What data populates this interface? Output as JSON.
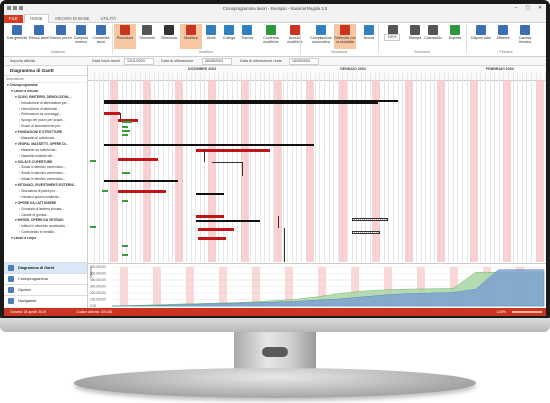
{
  "app": {
    "title": "Cronoprogramma lavori - Esempio - Namirial Regolo 3.0",
    "window_buttons": [
      "–",
      "▢",
      "✕"
    ]
  },
  "ribbon_tabs": [
    "FILE",
    "HOME",
    "ARCHIVI DI BASE",
    "UTILITÀ"
  ],
  "ribbon": {
    "buttons": [
      {
        "label": "Dati generali",
        "icon": "document-icon"
      },
      {
        "label": "Elenco lavori",
        "icon": "list-icon"
      },
      {
        "label": "Elenco prezzi",
        "icon": "price-list-icon"
      },
      {
        "label": "Computo metrico",
        "icon": "calculator-icon"
      },
      {
        "label": "Contabilità lavori",
        "icon": "book-icon"
      },
      {
        "label": "Procedure",
        "icon": "flag-icon"
      },
      {
        "label": "Strumenti",
        "icon": "tools-icon"
      },
      {
        "label": "Seleziona",
        "icon": "pointer-icon"
      },
      {
        "label": "Modifica",
        "icon": "move-icon"
      },
      {
        "label": "Dividi",
        "icon": "split-icon"
      },
      {
        "label": "Collega",
        "icon": "link-icon"
      },
      {
        "label": "Traccia",
        "icon": "trace-icon"
      },
      {
        "label": "Conferma modifiche",
        "icon": "check-icon"
      },
      {
        "label": "Annulla modifiche",
        "icon": "cancel-icon"
      },
      {
        "label": "Compilazione automatica",
        "icon": "auto-icon"
      },
      {
        "label": "Raffronta con la modalità",
        "icon": "compare-icon"
      },
      {
        "label": "Nuova",
        "icon": "new-icon"
      },
      {
        "label": "Zoom",
        "icon": "zoom-icon"
      },
      {
        "label": "Stampa",
        "icon": "print-icon"
      },
      {
        "label": "Calendario",
        "icon": "calendar-icon"
      },
      {
        "label": "Esporta",
        "icon": "export-icon"
      },
      {
        "label": "Disponi tutto",
        "icon": "arrange-icon"
      },
      {
        "label": "Affianca",
        "icon": "tile-icon"
      },
      {
        "label": "Cambia finestra",
        "icon": "window-icon"
      }
    ],
    "zoom_value": "100%",
    "groups": [
      "Gestione",
      "Modifica",
      "Visualizza",
      "Strumenti",
      "Finestra"
    ]
  },
  "subbar": {
    "import_label": "Importa attività",
    "start_label": "Data inizio lavori",
    "start_value": "12/11/2003",
    "finish_label": "Data di ultimazione",
    "finish_value": "26/08/2004",
    "actual_label": "Data di ultimazione reale",
    "actual_value": "15/09/2004"
  },
  "leftpane": {
    "title": "Diagramma di Gantt",
    "columns": "Descrizione",
    "rows": [
      {
        "text": "Cronoprogramma",
        "bold": true,
        "indent": 0
      },
      {
        "text": "Lavori a misura",
        "bold": true,
        "indent": 1
      },
      {
        "text": "SCAVI, RINTERRI, DEMOLIZIONI,...",
        "bold": true,
        "indent": 2
      },
      {
        "text": "Introduzione di attrezzature per...",
        "bold": false,
        "indent": 3
      },
      {
        "text": "Demolizione di fabbricati...",
        "bold": false,
        "indent": 3
      },
      {
        "text": "Perforazioni ed ancoraggi...",
        "bold": false,
        "indent": 3
      },
      {
        "text": "Spurgo del pozzo per acque...",
        "bold": false,
        "indent": 3
      },
      {
        "text": "Scavo di sbancamento per...",
        "bold": false,
        "indent": 3
      },
      {
        "text": "FONDAZIONI E STRUTTURE",
        "bold": true,
        "indent": 2
      },
      {
        "text": "Massetto di sottofondo...",
        "bold": false,
        "indent": 3
      },
      {
        "text": "VESPAI, MASSETTI, OPERE DI...",
        "bold": true,
        "indent": 2
      },
      {
        "text": "Massetto da sottofondo...",
        "bold": false,
        "indent": 3
      },
      {
        "text": "Massetto isolante del...",
        "bold": false,
        "indent": 3
      },
      {
        "text": "SOLAI E COPERTURE",
        "bold": true,
        "indent": 2
      },
      {
        "text": "Solaio in laterizio cementizio...",
        "bold": false,
        "indent": 3
      },
      {
        "text": "Solaio in laterizio cementizio...",
        "bold": false,
        "indent": 3
      },
      {
        "text": "Solaio in laterizio cementizio...",
        "bold": false,
        "indent": 3
      },
      {
        "text": "INTONACI, RIVESTIMENTI ESTERNI...",
        "bold": true,
        "indent": 2
      },
      {
        "text": "Stuccatura di pareti per...",
        "bold": false,
        "indent": 3
      },
      {
        "text": "Intonaco grezzo costituito...",
        "bold": false,
        "indent": 3
      },
      {
        "text": "OPERE DA LATTONIERE",
        "bold": true,
        "indent": 2
      },
      {
        "text": "Grondaia di lamiera zincata...",
        "bold": false,
        "indent": 3
      },
      {
        "text": "Canale di gronda...",
        "bold": false,
        "indent": 3
      },
      {
        "text": "INFISSI, OPERE DA VETRAIO",
        "bold": true,
        "indent": 2
      },
      {
        "text": "Infisso in alluminio anodizzato...",
        "bold": false,
        "indent": 3
      },
      {
        "text": "Controtelaio in metallo...",
        "bold": false,
        "indent": 3
      },
      {
        "text": "Lavori a corpo",
        "bold": true,
        "indent": 1
      }
    ],
    "nav": [
      {
        "label": "Diagramma di Gantt",
        "selected": true
      },
      {
        "label": "Cronoprogramma",
        "selected": false
      },
      {
        "label": "Opzioni",
        "selected": false
      },
      {
        "label": "Navigatore",
        "selected": false
      }
    ]
  },
  "gantt": {
    "months": [
      "DICEMBRE 2003",
      "GENNAIO 2004",
      "FEBBRAIO 2004"
    ]
  },
  "chart_data": {
    "type": "area",
    "yticks": [
      "600.000,00",
      "500.000,00",
      "400.000,00",
      "300.000,00",
      "200.000,00",
      "100.000,00",
      "0,00"
    ],
    "ylabel": "Importo",
    "series": [
      {
        "color": "#a9d7a4",
        "values": [
          0,
          10,
          20,
          30,
          40,
          50,
          60,
          80,
          100,
          140,
          190,
          230,
          250,
          260,
          265,
          270,
          520,
          520,
          520,
          520
        ]
      },
      {
        "color": "#7ea2d1",
        "values": [
          0,
          5,
          10,
          20,
          30,
          40,
          50,
          60,
          70,
          90,
          110,
          140,
          170,
          190,
          200,
          210,
          260,
          560,
          560,
          560
        ]
      }
    ],
    "ylim": [
      0,
      600
    ]
  },
  "status": {
    "left": "Giovedì 18 aprile 2019",
    "middle": "Codice Attività: 001481",
    "right": "100%"
  },
  "colors": {
    "accent": "#c8361f",
    "task": "#c0161a",
    "progress": "#3c9d3c",
    "weekend": "#f7c8c8"
  }
}
